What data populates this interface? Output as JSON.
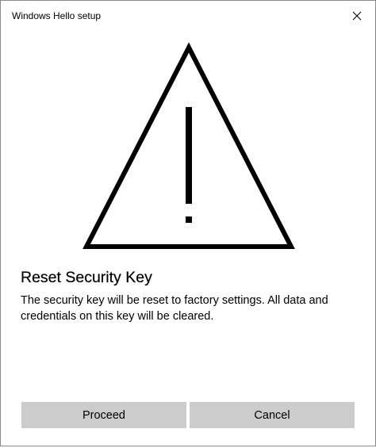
{
  "window": {
    "title": "Windows Hello setup",
    "close_icon": "close-icon"
  },
  "warning": {
    "icon": "warning-triangle-icon"
  },
  "dialog": {
    "heading": "Reset Security Key",
    "message": "The security key will be reset to factory settings. All data and credentials on this key will be cleared."
  },
  "buttons": {
    "proceed_label": "Proceed",
    "cancel_label": "Cancel"
  },
  "colors": {
    "button_background": "#cccccc",
    "text": "#000000",
    "background": "#ffffff"
  }
}
